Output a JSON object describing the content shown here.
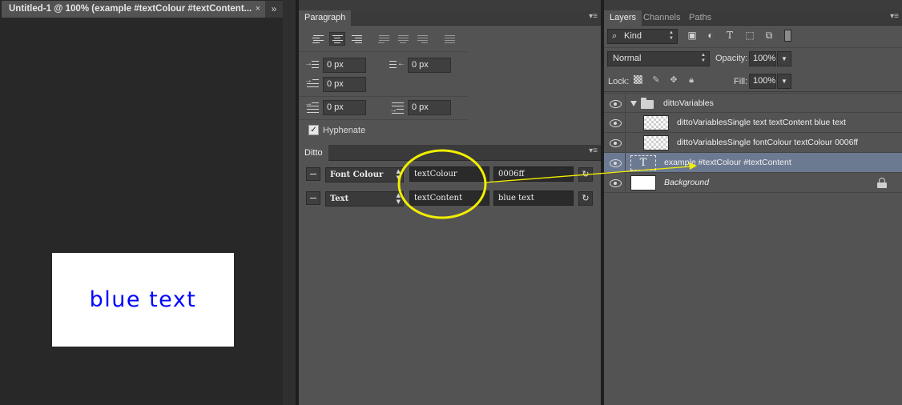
{
  "document": {
    "tab_title": "Untitled-1 @ 100% (example #textColour #textContent...",
    "close_glyph": "×",
    "expand_glyph": "»",
    "canvas_text": "blue text",
    "canvas_text_color": "#0006ff"
  },
  "paragraph_panel": {
    "tab_label": "Paragraph",
    "indent_left": "0 px",
    "indent_right": "0 px",
    "indent_first_line": "0 px",
    "space_before": "0 px",
    "space_after": "0 px",
    "hyphenate_label": "Hyphenate",
    "hyphenate_checked": true
  },
  "ditto_panel": {
    "tab_label": "Ditto",
    "rows": [
      {
        "property": "Font Colour",
        "variable": "textColour",
        "value": "0006ff"
      },
      {
        "property": "Text",
        "variable": "textContent",
        "value": "blue text"
      }
    ],
    "highlight_color": "#f2ee00"
  },
  "layers_panel": {
    "tabs": [
      "Layers",
      "Channels",
      "Paths"
    ],
    "filter_kind": "Kind",
    "blend_mode": "Normal",
    "opacity_label": "Opacity:",
    "opacity_value": "100%",
    "lock_label": "Lock:",
    "fill_label": "Fill:",
    "fill_value": "100%",
    "layers": [
      {
        "name": "dittoVariables",
        "type": "group"
      },
      {
        "name": "dittoVariablesSingle text textContent blue text",
        "type": "layer"
      },
      {
        "name": "dittoVariablesSingle fontColour textColour 0006ff",
        "type": "layer"
      },
      {
        "name": "example #textColour #textContent",
        "type": "text",
        "selected": true
      },
      {
        "name": "Background",
        "type": "background",
        "locked": true
      }
    ]
  },
  "icons": {
    "panel_menu": "panel-menu-icon",
    "eye": "eye-icon",
    "refresh": "refresh-icon",
    "search": "search-icon"
  }
}
